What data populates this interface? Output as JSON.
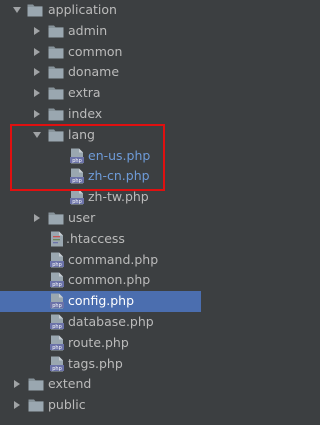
{
  "tree": {
    "root": {
      "label": "application",
      "expanded": true
    },
    "items": [
      {
        "label": "admin",
        "type": "folder"
      },
      {
        "label": "common",
        "type": "folder"
      },
      {
        "label": "doname",
        "type": "folder"
      },
      {
        "label": "extra",
        "type": "folder"
      },
      {
        "label": "index",
        "type": "folder"
      }
    ],
    "lang": {
      "label": "lang",
      "expanded": true,
      "files": [
        {
          "label": "en-us.php",
          "modified": true
        },
        {
          "label": "zh-cn.php",
          "modified": true
        },
        {
          "label": "zh-tw.php",
          "modified": false
        }
      ]
    },
    "user": {
      "label": "user"
    },
    "files": [
      {
        "label": ".htaccess",
        "icon": "htaccess-file-icon"
      },
      {
        "label": "command.php",
        "icon": "php-file-icon"
      },
      {
        "label": "common.php",
        "icon": "php-file-icon"
      },
      {
        "label": "config.php",
        "icon": "php-file-icon",
        "selected": true
      },
      {
        "label": "database.php",
        "icon": "php-file-icon"
      },
      {
        "label": "route.php",
        "icon": "php-file-icon"
      },
      {
        "label": "tags.php",
        "icon": "php-file-icon"
      }
    ],
    "bottom": [
      {
        "label": "extend"
      },
      {
        "label": "public"
      }
    ]
  },
  "colors": {
    "background": "#3c3f41",
    "selection": "#4b6eaf",
    "highlight_box": "#e01010",
    "modified_text": "#6e9bd8",
    "folder": "#87939a"
  }
}
